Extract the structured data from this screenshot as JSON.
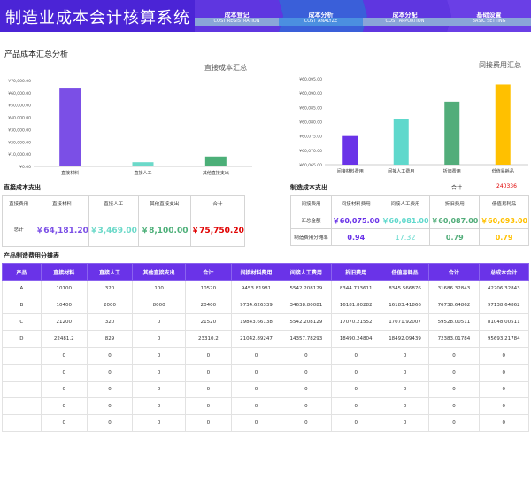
{
  "app": {
    "title": "制造业成本会计核算系统"
  },
  "nav": [
    {
      "cn": "成本登记",
      "en": "COST REGISTRATION"
    },
    {
      "cn": "成本分析",
      "en": "COST ANALYZE"
    },
    {
      "cn": "成本分配",
      "en": "COST APPORTION"
    },
    {
      "cn": "基础设置",
      "en": "BASIC SETTING"
    }
  ],
  "summary_title": "产品成本汇总分析",
  "chart_data": [
    {
      "type": "bar",
      "title": "直接成本汇总",
      "categories": [
        "直接材料",
        "直接人工",
        "其他直接支出"
      ],
      "values": [
        64181.2,
        3469,
        8100
      ],
      "colors": [
        "#7b4fe6",
        "#6cd9c9",
        "#4caf78"
      ],
      "ylim": [
        0,
        70000
      ],
      "yticks": [
        "¥0.00",
        "¥10,000.00",
        "¥20,000.00",
        "¥30,000.00",
        "¥40,000.00",
        "¥50,000.00",
        "¥60,000.00",
        "¥70,000.00"
      ]
    },
    {
      "type": "bar",
      "title": "间接费用汇总",
      "categories": [
        "间接材料费用",
        "间接人工费用",
        "折旧费用",
        "低值易耗品"
      ],
      "values": [
        60075,
        60081,
        60087,
        60093
      ],
      "colors": [
        "#6a33e8",
        "#5fd8cc",
        "#52ad7a",
        "#ffc000"
      ],
      "ylim": [
        60065,
        60095
      ],
      "yticks": [
        "¥60,065.00",
        "¥60,070.00",
        "¥60,075.00",
        "¥60,080.00",
        "¥60,085.00",
        "¥60,090.00",
        "¥60,095.00"
      ]
    }
  ],
  "direct": {
    "title": "直接成本支出",
    "headers": [
      "直接费用",
      "直接材料",
      "直接人工",
      "其他直接支出",
      "合计"
    ],
    "row_label": "总计",
    "values": [
      "￥64,181.20",
      "￥3,469.00",
      "￥8,100.00",
      "￥75,750.20"
    ]
  },
  "manufacturing": {
    "title": "制造成本支出",
    "total_label": "合计",
    "total_value": "240336",
    "headers": [
      "间接费用",
      "间接材料费用",
      "间接人工费用",
      "折旧费用",
      "低值易耗品"
    ],
    "amount_label": "汇总金额",
    "amounts": [
      "￥60,075.00",
      "￥60,081.00",
      "￥60,087.00",
      "￥60,093.00"
    ],
    "rate_label": "制造费用分摊率",
    "rates": [
      "0.94",
      "17.32",
      "0.79",
      "0.79"
    ]
  },
  "allocation": {
    "title": "产品制造费用分摊表",
    "headers": [
      "产品",
      "直接材料",
      "直接人工",
      "其他直接支出",
      "合计",
      "间接材料费用",
      "间接人工费用",
      "折旧费用",
      "低值易耗品",
      "合计",
      "总成本合计"
    ],
    "rows": [
      [
        "A",
        "10100",
        "320",
        "100",
        "10520",
        "9453.81981",
        "5542.208129",
        "8344.733611",
        "8345.566876",
        "31686.32843",
        "42206.32843"
      ],
      [
        "B",
        "10400",
        "2000",
        "8000",
        "20400",
        "9734.626339",
        "34638.80081",
        "16181.80282",
        "16183.41866",
        "76738.64862",
        "97138.64862"
      ],
      [
        "C",
        "21200",
        "320",
        "0",
        "21520",
        "19843.66138",
        "5542.208129",
        "17070.21552",
        "17071.92007",
        "59528.00511",
        "81048.00511"
      ],
      [
        "D",
        "22481.2",
        "829",
        "0",
        "23310.2",
        "21042.89247",
        "14357.78293",
        "18490.24804",
        "18492.09439",
        "72383.01784",
        "95693.21784"
      ],
      [
        "",
        "0",
        "0",
        "0",
        "0",
        "0",
        "0",
        "0",
        "0",
        "0",
        "0"
      ],
      [
        "",
        "0",
        "0",
        "0",
        "0",
        "0",
        "0",
        "0",
        "0",
        "0",
        "0"
      ],
      [
        "",
        "0",
        "0",
        "0",
        "0",
        "0",
        "0",
        "0",
        "0",
        "0",
        "0"
      ],
      [
        "",
        "0",
        "0",
        "0",
        "0",
        "0",
        "0",
        "0",
        "0",
        "0",
        "0"
      ],
      [
        "",
        "0",
        "0",
        "0",
        "0",
        "0",
        "0",
        "0",
        "0",
        "0",
        "0"
      ]
    ]
  }
}
